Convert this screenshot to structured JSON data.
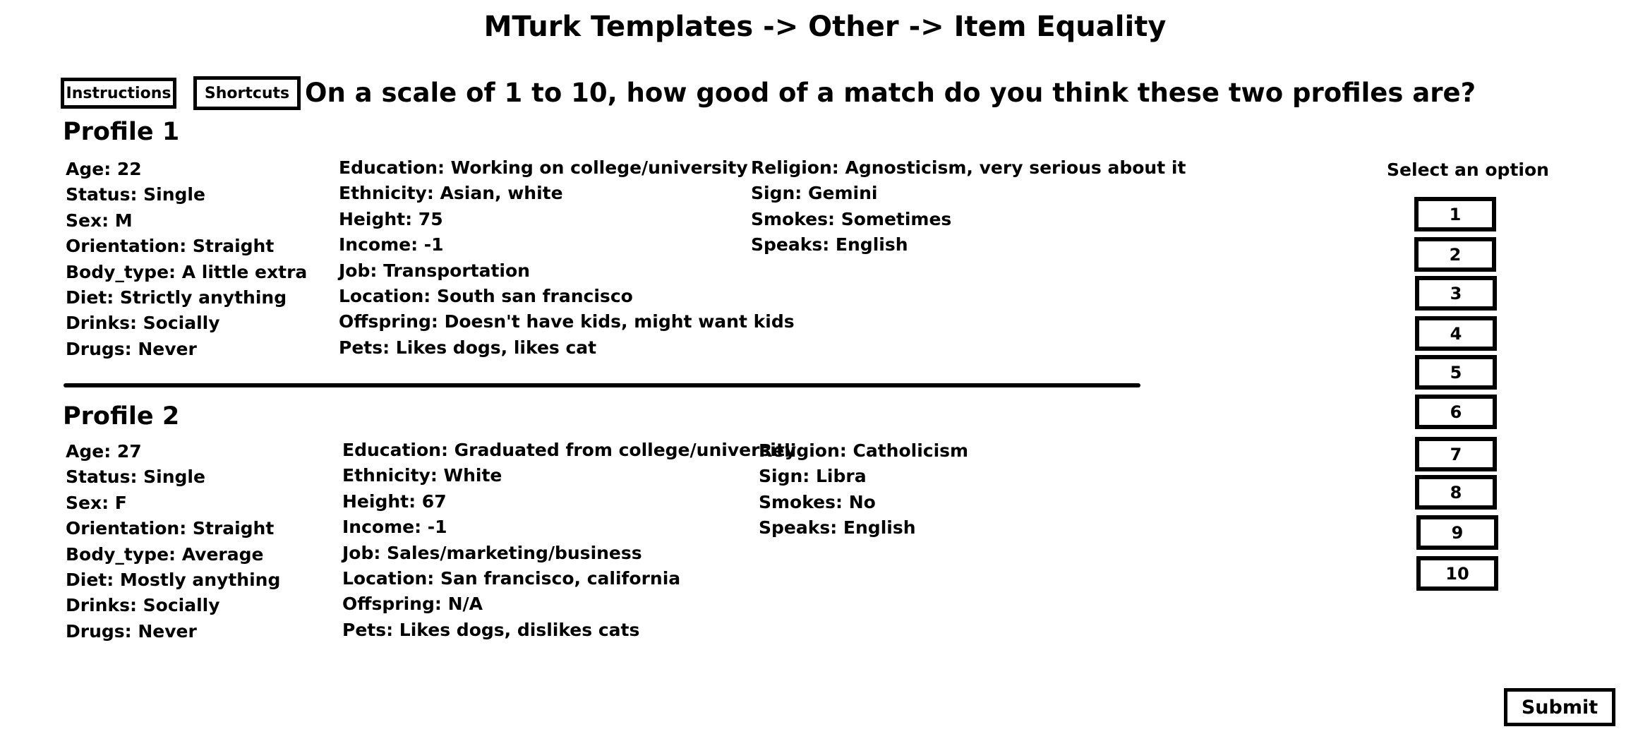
{
  "page": {
    "title": "MTurk Templates -> Other -> Item Equality"
  },
  "toolbar": {
    "instructions_label": "Instructions",
    "shortcuts_label": "Shortcuts",
    "question": "On a scale of 1 to 10, how good of a match do you think these two profiles are?"
  },
  "profiles": [
    {
      "heading": "Profile 1",
      "col1": [
        "Age: 22",
        "Status: Single",
        "Sex: M",
        "Orientation: Straight",
        "Body_type: A little extra",
        "Diet: Strictly anything",
        "Drinks: Socially",
        "Drugs: Never"
      ],
      "col2": [
        "Education: Working on college/university",
        "Ethnicity: Asian, white",
        "Height: 75",
        "Income: -1",
        "Job: Transportation",
        "Location: South san francisco",
        "Offspring: Doesn't have kids, might want kids",
        "Pets: Likes dogs, likes cat"
      ],
      "col3": [
        "Religion: Agnosticism, very serious about it",
        "Sign: Gemini",
        "Smokes: Sometimes",
        "Speaks: English"
      ]
    },
    {
      "heading": "Profile 2",
      "col1": [
        "Age: 27",
        "Status: Single",
        "Sex: F",
        "Orientation: Straight",
        "Body_type: Average",
        "Diet: Mostly anything",
        "Drinks: Socially",
        "Drugs: Never"
      ],
      "col2": [
        "Education: Graduated from college/university",
        "Ethnicity: White",
        "Height: 67",
        "Income: -1",
        "Job: Sales/marketing/business",
        "Location: San francisco, california",
        "Offspring: N/A",
        "Pets: Likes dogs, dislikes cats"
      ],
      "col3": [
        "Religion: Catholicism",
        "Sign: Libra",
        "Smokes: No",
        "Speaks: English"
      ]
    }
  ],
  "rating": {
    "label": "Select an option",
    "options": [
      "1",
      "2",
      "3",
      "4",
      "5",
      "6",
      "7",
      "8",
      "9",
      "10"
    ]
  },
  "submit_label": "Submit"
}
